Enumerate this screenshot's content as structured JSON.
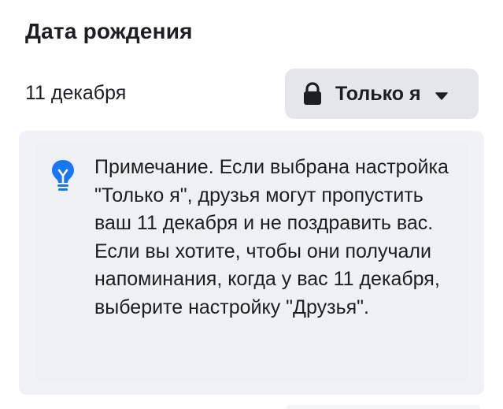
{
  "section": {
    "title": "Дата рождения",
    "birthday_value": "11 декабря"
  },
  "privacy": {
    "label": "Только я",
    "icon": "lock-icon",
    "dropdown_icon": "caret-down-icon"
  },
  "note": {
    "icon": "lightbulb-icon",
    "accent_color": "#1877f2",
    "text": "Примечание. Если выбрана настройка \"Только я\", друзья могут пропустить ваш 11 декабря и не поздравить вас. Если вы хотите, чтобы они получали напоминания, когда у вас 11 декабря, выберите настройку \"Друзья\"."
  }
}
